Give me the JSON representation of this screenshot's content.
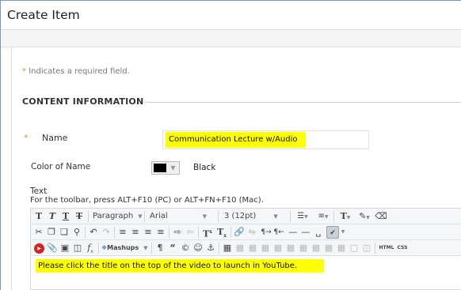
{
  "page": {
    "title": "Create Item"
  },
  "form": {
    "required_star": "*",
    "required_note": "Indicates a required field.",
    "section_title": "CONTENT INFORMATION",
    "name_label": "Name",
    "name_value": "Communication Lecture w/Audio",
    "color_label": "Color of Name",
    "color_name": "Black",
    "color_swatch": "#000000",
    "text_label": "Text",
    "toolbar_hint": "For the toolbar, press ALT+F10 (PC) or ALT+FN+F10 (Mac)."
  },
  "editor": {
    "paragraph": "Paragraph",
    "font": "Arial",
    "size": "3 (12pt)",
    "mashups": "Mashups",
    "html_label": "HTML",
    "css_label": "CSS",
    "body_text": "Please click the title on the top of the video to launch in YouTube."
  },
  "colors": {
    "highlight": "#ffff00",
    "required": "#e88a1a",
    "frame": "#7a96b8"
  }
}
